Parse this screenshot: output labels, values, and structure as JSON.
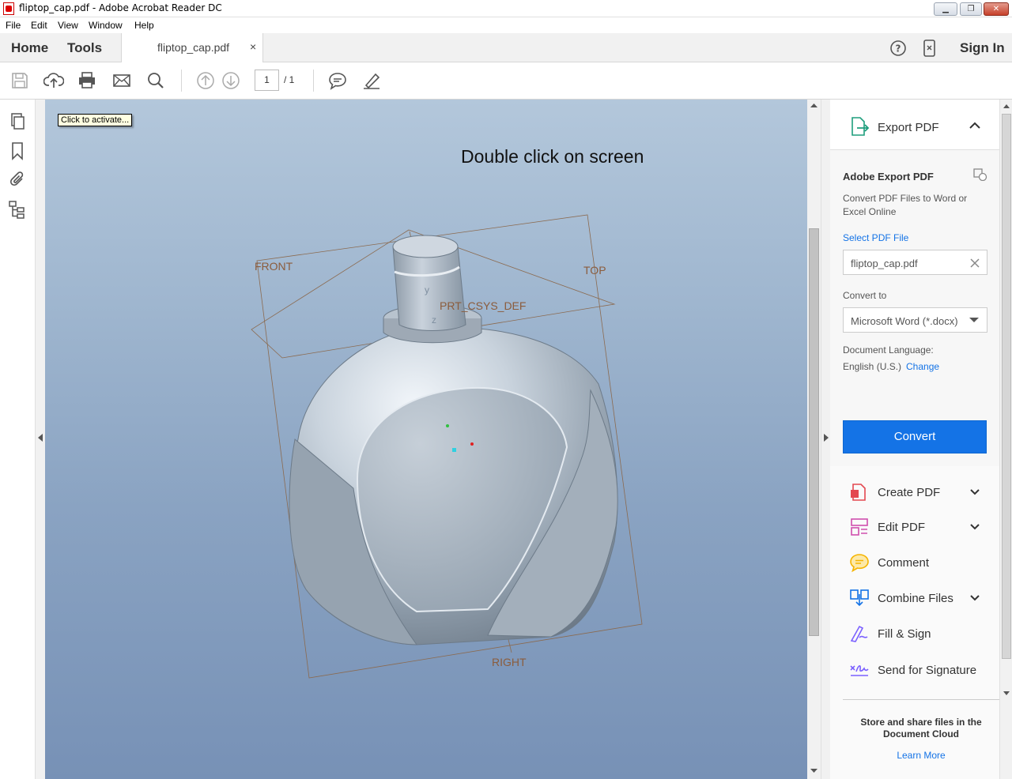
{
  "window": {
    "title": "fliptop_cap.pdf - Adobe Acrobat Reader DC"
  },
  "menu": [
    "File",
    "Edit",
    "View",
    "Window",
    "Help"
  ],
  "tabs": {
    "home": "Home",
    "tools": "Tools",
    "document": "fliptop_cap.pdf",
    "close": "×",
    "sign_in": "Sign In"
  },
  "toolbar": {
    "page_current": "1",
    "page_total": "/ 1"
  },
  "viewer": {
    "tooltip": "Click to activate...",
    "headline": "Double click on screen",
    "labels": {
      "front": "FRONT",
      "top": "TOP",
      "right": "RIGHT",
      "csys": "PRT_CSYS_DEF",
      "y": "y",
      "z": "z"
    }
  },
  "export_panel": {
    "header": "Export PDF",
    "title": "Adobe Export PDF",
    "description": "Convert PDF Files to Word or Excel Online",
    "select_file_link": "Select PDF File",
    "file_name": "fliptop_cap.pdf",
    "convert_to_label": "Convert to",
    "convert_to_value": "Microsoft Word (*.docx)",
    "language_label": "Document Language:",
    "language_value": "English (U.S.)",
    "change_link": "Change",
    "convert_button": "Convert"
  },
  "tool_list": [
    {
      "label": "Create PDF",
      "icon": "create-pdf-icon",
      "color": "#e34850"
    },
    {
      "label": "Edit PDF",
      "icon": "edit-pdf-icon",
      "color": "#d04fae"
    },
    {
      "label": "Comment",
      "icon": "comment-icon",
      "color": "#f5b400"
    },
    {
      "label": "Combine Files",
      "icon": "combine-files-icon",
      "color": "#1473e6"
    },
    {
      "label": "Fill & Sign",
      "icon": "fill-sign-icon",
      "color": "#7b61ff"
    },
    {
      "label": "Send for Signature",
      "icon": "send-signature-icon",
      "color": "#7b61ff"
    }
  ],
  "footer": {
    "text": "Store and share files in the Document Cloud",
    "link": "Learn More"
  },
  "colors": {
    "accent": "#1473e6",
    "export_icon": "#1e9e7d"
  }
}
